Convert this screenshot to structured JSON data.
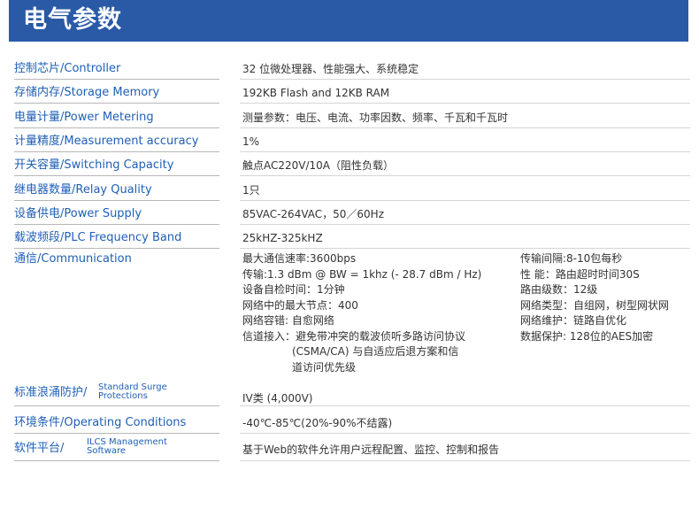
{
  "header": {
    "title": "电气参数"
  },
  "rows": [
    {
      "label": "控制芯片/Controller",
      "value": "32 位微处理器、性能强大、系统稳定"
    },
    {
      "label": "存储内存/Storage Memory",
      "value": "192KB Flash  and  12KB RAM"
    },
    {
      "label": "电量计量/Power Metering",
      "value": "测量参数：电压、电流、功率因数、频率、千瓦和千瓦时"
    },
    {
      "label": "计量精度/Measurement accuracy",
      "value": "1%"
    },
    {
      "label": "开关容量/Switching Capacity",
      "value": "触点AC220V/10A（阻性负载）"
    },
    {
      "label": "继电器数量/Relay Quality",
      "value": "1只"
    },
    {
      "label": "设备供电/Power Supply",
      "value": "85VAC-264VAC，50／60Hz"
    },
    {
      "label": "载波频段/PLC Frequency Band",
      "value": "25kHZ-325kHZ"
    }
  ],
  "communication": {
    "label": "通信/Communication",
    "left": [
      "最大通信速率:3600bps",
      "传输:1.3 dBm @ BW = 1khz (- 28.7 dBm / Hz)",
      "设备自检时间：1分钟",
      "网络中的最大节点：400",
      "网络容错: 自愈网络",
      "信道接入：避免带冲突的载波侦听多路访问协议",
      "(CSMA/CA) 与自适应后退方案和信",
      "道访问优先级"
    ],
    "right": [
      "传输间隔:8-10包每秒",
      "性      能：路由超时时间30S",
      "路由级数：12级",
      "网络类型：自组网，树型网状网",
      "网络维护：链路自优化",
      "数据保护:  128位的AES加密"
    ]
  },
  "surge": {
    "label_cn": "标准浪涌防护/",
    "label_en_1": "Standard Surge",
    "label_en_2": "Protections",
    "value": "IV类 (4,000V)"
  },
  "env": {
    "label": "环境条件/Operating Conditions",
    "value": "-40℃-85℃(20%-90%不结露)"
  },
  "software": {
    "label_cn": "软件平台/",
    "label_en_1": "ILCS Management",
    "label_en_2": "Software",
    "value": "基于Web的软件允许用户远程配置、监控、控制和报告"
  }
}
